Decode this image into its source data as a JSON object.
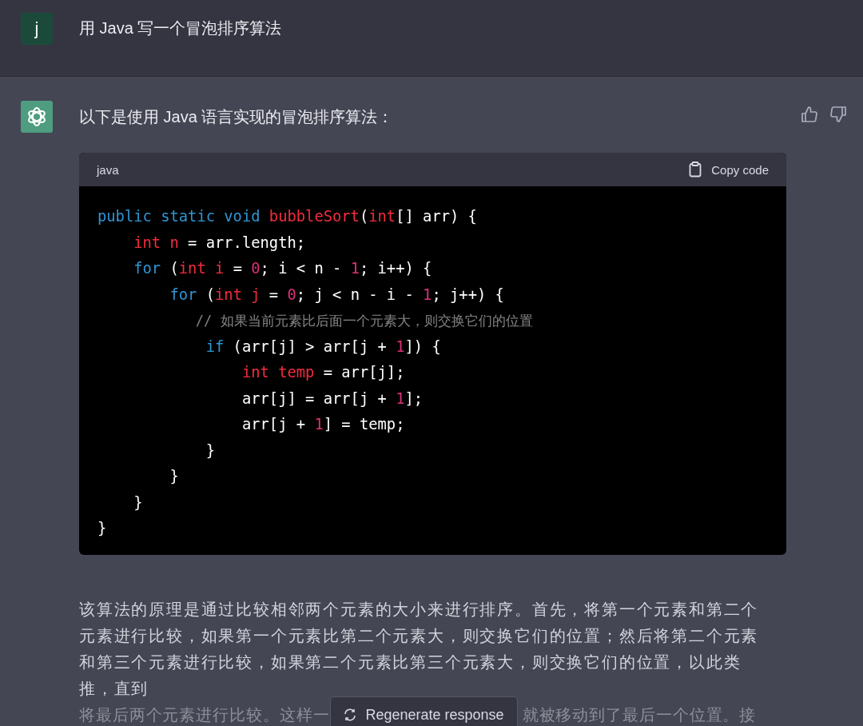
{
  "user_message": {
    "avatar": "j",
    "text": "用 Java 写一个冒泡排序算法"
  },
  "assistant_message": {
    "intro": "以下是使用 Java 语言实现的冒泡排序算法：",
    "code_block": {
      "language": "java",
      "copy_label": "Copy code",
      "lines": [
        [
          {
            "kind": "keyword",
            "text": "public static void "
          },
          {
            "kind": "function",
            "text": "bubbleSort"
          },
          {
            "kind": "plain",
            "text": "("
          },
          {
            "kind": "type",
            "text": "int"
          },
          {
            "kind": "plain",
            "text": "[] arr) {"
          }
        ],
        [
          {
            "kind": "type",
            "text": "    int "
          },
          {
            "kind": "variable",
            "text": "n"
          },
          {
            "kind": "plain",
            "text": " = arr.length;"
          }
        ],
        [
          {
            "kind": "keyword",
            "text": "    for"
          },
          {
            "kind": "plain",
            "text": " ("
          },
          {
            "kind": "type",
            "text": "int "
          },
          {
            "kind": "variable",
            "text": "i"
          },
          {
            "kind": "plain",
            "text": " = "
          },
          {
            "kind": "number",
            "text": "0"
          },
          {
            "kind": "plain",
            "text": "; i < n - "
          },
          {
            "kind": "number",
            "text": "1"
          },
          {
            "kind": "plain",
            "text": "; i++) {"
          }
        ],
        [
          {
            "kind": "keyword",
            "text": "        for"
          },
          {
            "kind": "plain",
            "text": " ("
          },
          {
            "kind": "type",
            "text": "int "
          },
          {
            "kind": "variable",
            "text": "j"
          },
          {
            "kind": "plain",
            "text": " = "
          },
          {
            "kind": "number",
            "text": "0"
          },
          {
            "kind": "plain",
            "text": "; j < n - i - "
          },
          {
            "kind": "number",
            "text": "1"
          },
          {
            "kind": "plain",
            "text": "; j++) {"
          }
        ],
        [
          {
            "kind": "comment",
            "text": "            // 如果当前元素比后面一个元素大，则交换它们的位置"
          }
        ],
        [
          {
            "kind": "keyword",
            "text": "            if"
          },
          {
            "kind": "plain",
            "text": " (arr[j] > arr[j + "
          },
          {
            "kind": "number",
            "text": "1"
          },
          {
            "kind": "plain",
            "text": "]) {"
          }
        ],
        [
          {
            "kind": "type",
            "text": "                int "
          },
          {
            "kind": "variable",
            "text": "temp"
          },
          {
            "kind": "plain",
            "text": " = arr[j];"
          }
        ],
        [
          {
            "kind": "plain",
            "text": "                arr[j] = arr[j + "
          },
          {
            "kind": "number",
            "text": "1"
          },
          {
            "kind": "plain",
            "text": "];"
          }
        ],
        [
          {
            "kind": "plain",
            "text": "                arr[j + "
          },
          {
            "kind": "number",
            "text": "1"
          },
          {
            "kind": "plain",
            "text": "] = temp;"
          }
        ],
        [
          {
            "kind": "plain",
            "text": "            }"
          }
        ],
        [
          {
            "kind": "plain",
            "text": "        }"
          }
        ],
        [
          {
            "kind": "plain",
            "text": "    }"
          }
        ],
        [
          {
            "kind": "plain",
            "text": "}"
          }
        ]
      ]
    },
    "explanation": "该算法的原理是通过比较相邻两个元素的大小来进行排序。首先，将第一个元素和第二个元素进行比较，如果第一个元素比第二个元素大，则交换它们的位置；然后将第二个元素和第三个元素进行比较，如果第二个元素比第三个元素大，则交换它们的位置，以此类推，直到",
    "faded_line_start": "将最后两个元素进行比较。这样一",
    "faded_line_end": "就被移动到了最后一个位置。接"
  },
  "regenerate_button": "Regenerate response"
}
